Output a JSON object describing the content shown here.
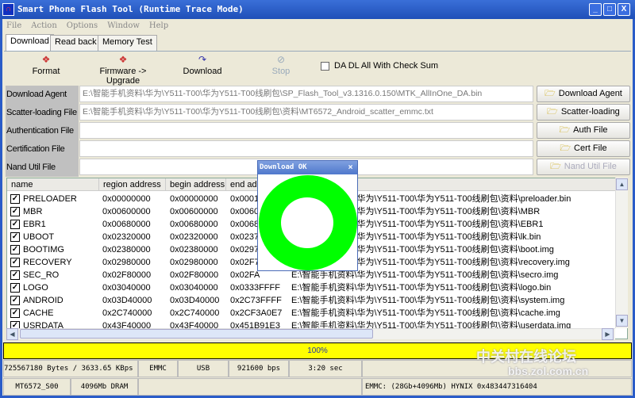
{
  "window": {
    "title": "Smart Phone Flash Tool (Runtime Trace Mode)"
  },
  "menu": [
    "File",
    "Action",
    "Options",
    "Window",
    "Help"
  ],
  "tabs": [
    "Download",
    "Read back",
    "Memory Test"
  ],
  "toolbar": {
    "format": "Format",
    "firmware_upgrade": "Firmware -> Upgrade",
    "download": "Download",
    "stop": "Stop",
    "checksum_label": "DA DL All With Check Sum",
    "checksum_checked": false
  },
  "files": [
    {
      "label": "Download Agent",
      "value": "E:\\智能手机资料\\华为\\Y511-T00\\华为Y511-T00线刷包\\SP_Flash_Tool_v3.1316.0.150\\MTK_AllInOne_DA.bin",
      "button": "Download Agent",
      "enabled": true
    },
    {
      "label": "Scatter-loading File",
      "value": "E:\\智能手机资料\\华为\\Y511-T00\\华为Y511-T00线刷包\\资料\\MT6572_Android_scatter_emmc.txt",
      "button": "Scatter-loading",
      "enabled": true
    },
    {
      "label": "Authentication File",
      "value": "",
      "button": "Auth File",
      "enabled": true
    },
    {
      "label": "Certification File",
      "value": "",
      "button": "Cert File",
      "enabled": true
    },
    {
      "label": "Nand Util File",
      "value": "",
      "button": "Nand Util File",
      "enabled": false
    }
  ],
  "table": {
    "columns": [
      "name",
      "region address",
      "begin address",
      "end address",
      ""
    ],
    "rows": [
      {
        "name": "PRELOADER",
        "region": "0x00000000",
        "begin": "0x00000000",
        "end": "0x0001",
        "path": "E:\\智能手机资料\\华为\\Y511-T00\\华为Y511-T00线刷包\\资料\\preloader.bin"
      },
      {
        "name": "MBR",
        "region": "0x00600000",
        "begin": "0x00600000",
        "end": "0x0060",
        "path": "E:\\智能手机资料\\华为\\Y511-T00\\华为Y511-T00线刷包\\资料\\MBR"
      },
      {
        "name": "EBR1",
        "region": "0x00680000",
        "begin": "0x00680000",
        "end": "0x0068",
        "path": "E:\\智能手机资料\\华为\\Y511-T00\\华为Y511-T00线刷包\\资料\\EBR1"
      },
      {
        "name": "UBOOT",
        "region": "0x02320000",
        "begin": "0x02320000",
        "end": "0x0237",
        "path": "E:\\智能手机资料\\华为\\Y511-T00\\华为Y511-T00线刷包\\资料\\lk.bin"
      },
      {
        "name": "BOOTIMG",
        "region": "0x02380000",
        "begin": "0x02380000",
        "end": "0x0297",
        "path": "E:\\智能手机资料\\华为\\Y511-T00\\华为Y511-T00线刷包\\资料\\boot.img"
      },
      {
        "name": "RECOVERY",
        "region": "0x02980000",
        "begin": "0x02980000",
        "end": "0x02F7",
        "path": "E:\\智能手机资料\\华为\\Y511-T00\\华为Y511-T00线刷包\\资料\\recovery.img"
      },
      {
        "name": "SEC_RO",
        "region": "0x02F80000",
        "begin": "0x02F80000",
        "end": "0x02FA",
        "path": "E:\\智能手机资料\\华为\\Y511-T00\\华为Y511-T00线刷包\\资料\\secro.img"
      },
      {
        "name": "LOGO",
        "region": "0x03040000",
        "begin": "0x03040000",
        "end": "0x0333FFFF",
        "path": "E:\\智能手机资料\\华为\\Y511-T00\\华为Y511-T00线刷包\\资料\\logo.bin"
      },
      {
        "name": "ANDROID",
        "region": "0x03D40000",
        "begin": "0x03D40000",
        "end": "0x2C73FFFF",
        "path": "E:\\智能手机资料\\华为\\Y511-T00\\华为Y511-T00线刷包\\资料\\system.img"
      },
      {
        "name": "CACHE",
        "region": "0x2C740000",
        "begin": "0x2C740000",
        "end": "0x2CF3A0E7",
        "path": "E:\\智能手机资料\\华为\\Y511-T00\\华为Y511-T00线刷包\\资料\\cache.img"
      },
      {
        "name": "USRDATA",
        "region": "0x43F40000",
        "begin": "0x43F40000",
        "end": "0x451B91E3",
        "path": "E:\\智能手机资料\\华为\\Y511-T00\\华为Y511-T00线刷包\\资料\\userdata.img"
      }
    ]
  },
  "progress": {
    "percent": 100,
    "label": "100%",
    "color": "#ffff00"
  },
  "status1": [
    "725567180 Bytes / 3633.65 KBps",
    "EMMC",
    "USB",
    "921600 bps",
    "3:20 sec",
    ""
  ],
  "status2": [
    "MT6572_S00",
    "4096Mb DRAM",
    "",
    "EMMC: (28Gb+4096Mb) HYNIX 0x483447316404"
  ],
  "dialog": {
    "title": "Download OK",
    "close": "×",
    "ring_color": "#00ff00"
  },
  "watermark": {
    "line1": "中关村在线论坛",
    "line2": "bbs.zol.com.cn"
  }
}
